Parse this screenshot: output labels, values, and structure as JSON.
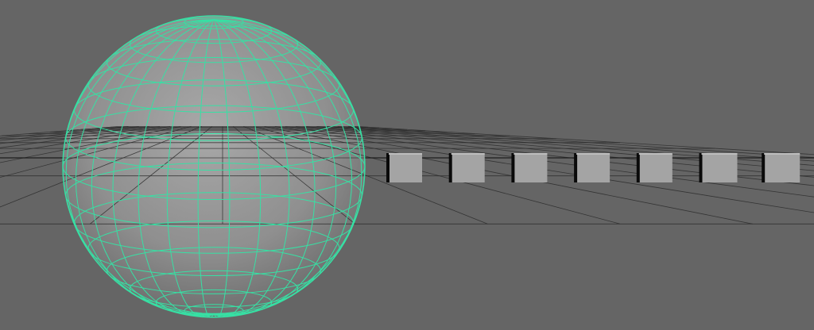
{
  "viewport": {
    "panel": "3d-perspective-viewport",
    "background_color": "#656565",
    "grid_color": "#2f2f2f",
    "grid_visible": true
  },
  "scene": {
    "objects": [
      {
        "type": "sphere",
        "name": "sphere",
        "selected": true,
        "wireframe_on_shaded": true,
        "highlight_color": "#37e0a4",
        "base_color": "#9a9a9a"
      },
      {
        "type": "cube",
        "name": "cube-1",
        "selected": false
      },
      {
        "type": "cube",
        "name": "cube-2",
        "selected": false
      },
      {
        "type": "cube",
        "name": "cube-3",
        "selected": false
      },
      {
        "type": "cube",
        "name": "cube-4",
        "selected": false
      },
      {
        "type": "cube",
        "name": "cube-5",
        "selected": false
      },
      {
        "type": "cube",
        "name": "cube-6",
        "selected": false
      },
      {
        "type": "cube",
        "name": "cube-7",
        "selected": false
      }
    ],
    "cube_colors": {
      "face": "#a4a4a4",
      "top": "#bdbdbd",
      "side": "#0a0a0a"
    }
  }
}
